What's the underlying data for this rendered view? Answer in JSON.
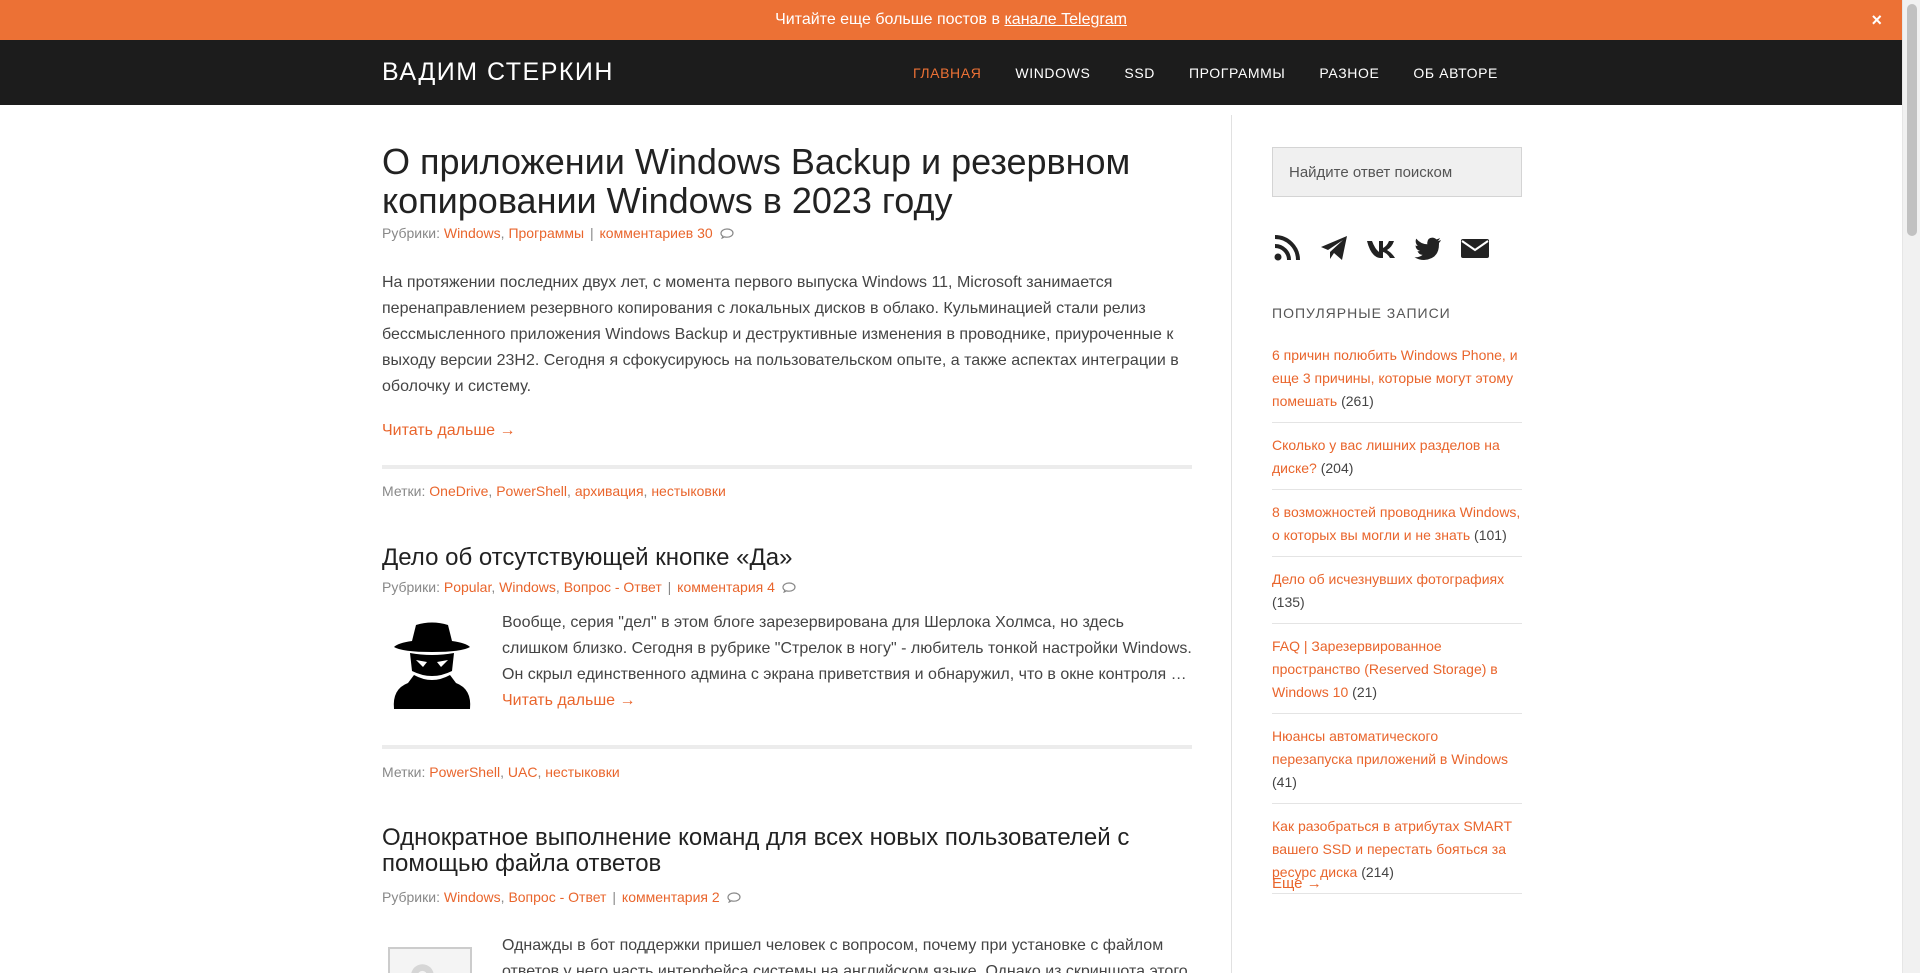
{
  "notice": {
    "text": "Читайте еще больше постов в ",
    "link": "канале Telegram",
    "close": "×"
  },
  "header": {
    "site_title": "ВАДИМ СТЕРКИН",
    "nav": [
      "ГЛАВНАЯ",
      "WINDOWS",
      "SSD",
      "ПРОГРАММЫ",
      "РАЗНОЕ",
      "ОБ АВТОРЕ"
    ]
  },
  "posts": [
    {
      "title": "О приложении Windows Backup и резервном копировании Windows в 2023 году",
      "meta_prefix": "Рубрики: ",
      "categories": [
        "Windows",
        "Программы"
      ],
      "comments": "комментариев 30",
      "body": "На протяжении последних двух лет, с момента первого выпуска Windows 11, Microsoft занимается перенаправлением резервного копирования с локальных дисков в облако. Кульминацией стали релиз бессмысленного приложения Windows Backup и деструктивные изменения в проводнике, приуроченные к выходу версии 23H2. Сегодня я сфокусируюсь на пользовательском опыте, а также аспектах интеграции в оболочку и систему.",
      "read_more": "Читать дальше →",
      "tags_prefix": "Метки: ",
      "tags": [
        "OneDrive",
        "PowerShell",
        "архивация",
        "нестыковки"
      ]
    },
    {
      "title": "Дело об отсутствующей кнопке «Да»",
      "meta_prefix": "Рубрики: ",
      "categories": [
        "Popular",
        "Windows",
        "Вопрос - Ответ"
      ],
      "comments": "комментария 4",
      "body": "Вообще, серия \"дел\" в этом блоге зарезервирована для Шерлока Холмса, но здесь слишком близко. Сегодня в рубрике \"Стрелок в ногу\" - любитель тонкой настройки Windows. Он скрыл единственного админа с экрана приветствия и обнаружил, что в окне контроля … ",
      "read_more": "Читать дальше →",
      "tags_prefix": "Метки: ",
      "tags": [
        "PowerShell",
        "UAC",
        "нестыковки"
      ]
    },
    {
      "title": "Однократное выполнение команд для всех новых пользователей с помощью файла ответов",
      "meta_prefix": "Рубрики: ",
      "categories": [
        "Windows",
        "Вопрос - Ответ"
      ],
      "comments": "комментария 2",
      "body": "Однажды в бот поддержки пришел человек с вопросом, почему при установке с файлом ответов у него часть интерфейса системы на английском языке. Однако из скриншота этого"
    }
  ],
  "sidebar": {
    "search_placeholder": "Найдите ответ поиском",
    "social": [
      "rss-icon",
      "telegram-icon",
      "vk-icon",
      "twitter-icon",
      "email-icon"
    ],
    "popular_heading": "ПОПУЛЯРНЫЕ ЗАПИСИ",
    "popular": [
      {
        "title": "6 причин полюбить Windows Phone, и еще 3 причины, которые могут этому помешать",
        "count": " (261)"
      },
      {
        "title": "Сколько у вас лишних разделов на диске?",
        "count": " (204)"
      },
      {
        "title": "8 возможностей проводника Windows, о которых вы могли и не знать",
        "count": " (101)"
      },
      {
        "title": "Дело об исчезнувших фотографиях",
        "count": " (135)"
      },
      {
        "title": "FAQ | Зарезервированное пространство (Reserved Storage) в Windows 10",
        "count": " (21)"
      },
      {
        "title": "Нюансы автоматического перезапуска приложений в Windows",
        "count": " (41)"
      },
      {
        "title": "Как разобраться в атрибутах SMART вашего SSD и перестать бояться за ресурс диска",
        "count": " (214)"
      }
    ],
    "more": "Еще →"
  },
  "colors": {
    "accent": "#ec7135",
    "header_bg": "#1c1c1c"
  }
}
